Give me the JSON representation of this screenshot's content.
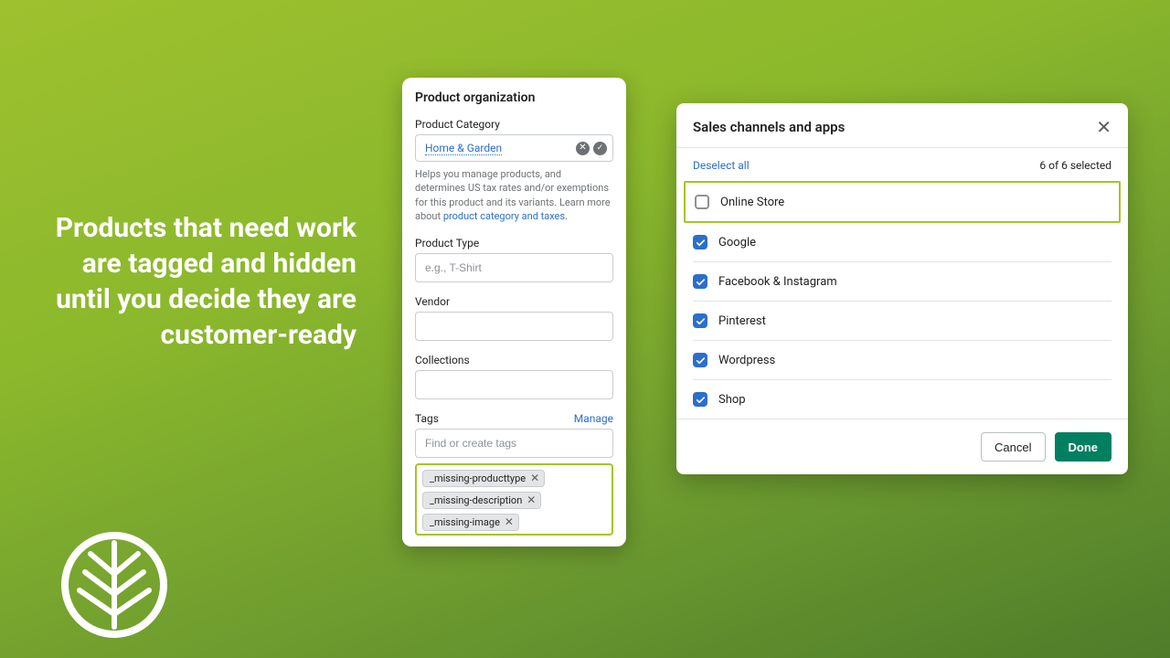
{
  "headline": "Products that need work are tagged and hidden until you decide they are customer-ready",
  "po": {
    "title": "Product organization",
    "category_label": "Product Category",
    "category_value": "Home & Garden",
    "help_pre": "Helps you manage products, and determines US tax rates and/or exemptions for this product and its variants. Learn more about ",
    "help_link": "product category and taxes",
    "type_label": "Product Type",
    "type_placeholder": "e.g., T-Shirt",
    "vendor_label": "Vendor",
    "collections_label": "Collections",
    "tags_label": "Tags",
    "tags_manage": "Manage",
    "tags_placeholder": "Find or create tags",
    "tags": [
      "_missing-producttype",
      "_missing-description",
      "_missing-image"
    ]
  },
  "modal": {
    "title": "Sales channels and apps",
    "deselect": "Deselect all",
    "count_text": "6 of 6 selected",
    "channels": [
      {
        "label": "Online Store",
        "checked": false,
        "highlight": true
      },
      {
        "label": "Google",
        "checked": true
      },
      {
        "label": "Facebook & Instagram",
        "checked": true
      },
      {
        "label": "Pinterest",
        "checked": true
      },
      {
        "label": "Wordpress",
        "checked": true
      },
      {
        "label": "Shop",
        "checked": true
      }
    ],
    "cancel": "Cancel",
    "done": "Done"
  }
}
